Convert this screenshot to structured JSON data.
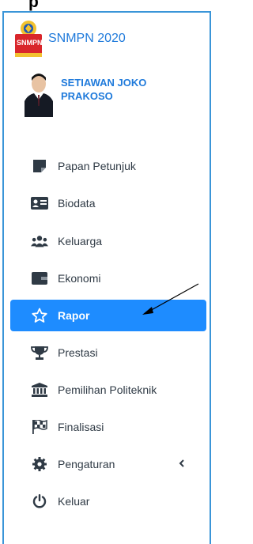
{
  "brand": {
    "title": "SNMPN 2020",
    "logo_text": "SNMPN"
  },
  "user": {
    "name": "SETIAWAN JOKO PRAKOSO"
  },
  "menu": {
    "items": [
      {
        "label": "Papan Petunjuk",
        "icon": "note-icon"
      },
      {
        "label": "Biodata",
        "icon": "id-card-icon"
      },
      {
        "label": "Keluarga",
        "icon": "users-icon"
      },
      {
        "label": "Ekonomi",
        "icon": "wallet-icon"
      },
      {
        "label": "Rapor",
        "icon": "star-icon",
        "active": true
      },
      {
        "label": "Prestasi",
        "icon": "trophy-icon"
      },
      {
        "label": "Pemilihan Politeknik",
        "icon": "university-icon"
      },
      {
        "label": "Finalisasi",
        "icon": "flag-checkered-icon"
      },
      {
        "label": "Pengaturan",
        "icon": "gear-icon"
      },
      {
        "label": "Keluar",
        "icon": "power-icon"
      }
    ]
  },
  "colors": {
    "accent": "#1e8cff",
    "brand_text": "#1f7adb",
    "border": "#3a95d8"
  }
}
